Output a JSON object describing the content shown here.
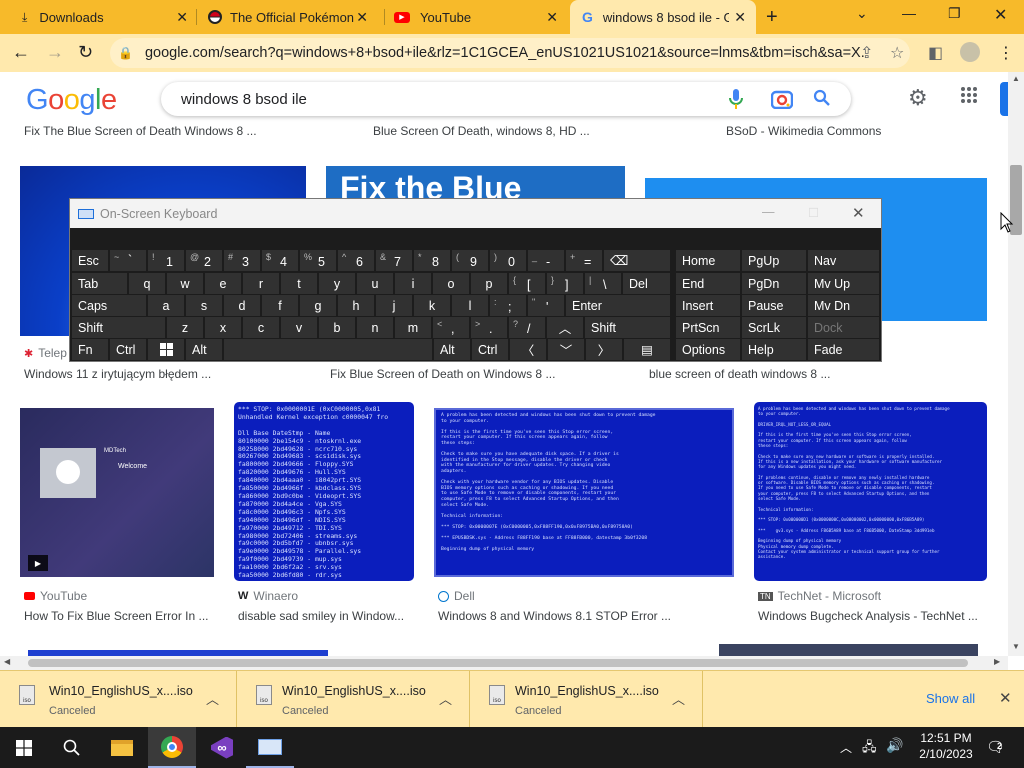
{
  "browser": {
    "tabs": [
      {
        "title": "Downloads",
        "icon": "download-icon"
      },
      {
        "title": "The Official Pokémon W",
        "icon": "pokeball-icon"
      },
      {
        "title": "YouTube",
        "icon": "youtube-icon"
      },
      {
        "title": "windows 8 bsod ile - G",
        "icon": "google-icon",
        "active": true
      }
    ],
    "new_tab": "+",
    "url": "google.com/search?q=windows+8+bsod+ile&rlz=1C1GCEA_enUS1021US1021&source=lnms&tbm=isch&sa=X...",
    "colors": {
      "tab_strip": "#f7ba2a",
      "toolbar": "#ffe9ad"
    }
  },
  "google": {
    "logo": [
      "G",
      "o",
      "o",
      "g",
      "l",
      "e"
    ],
    "query": "windows 8 bsod ile"
  },
  "results": {
    "row0_captions": [
      "Fix The Blue Screen of Death Windows 8 ...",
      "Blue Screen Of Death, windows 8, HD ...",
      "BSoD - Wikimedia Commons"
    ],
    "row1": {
      "fix_text": "Fix the Blue",
      "sources": [
        "Telep"
      ],
      "captions": [
        "Windows 11 z irytującym błędem ...",
        "Fix Blue Screen of Death on Windows 8 ...",
        "blue screen of death windows 8 ..."
      ]
    },
    "row2": [
      {
        "source": "YouTube",
        "caption": "How To Fix Blue Screen Error In ...",
        "thumb_brand": "MDTech",
        "thumb_text": "Welcome"
      },
      {
        "source": "Winaero",
        "caption": "disable sad smiley in Window..."
      },
      {
        "source": "Dell",
        "caption": "Windows 8 and Windows 8.1 STOP Error ..."
      },
      {
        "source": "TechNet - Microsoft",
        "caption": "Windows Bugcheck Analysis - TechNet ..."
      }
    ],
    "bsod2_text": "*** STOP: 0x0000001E (0xC0000005,0x81\nUnhandled Kernel exception c0000047 fro\n\nDll Base DateStmp - Name\n80100000 2be154c9 - ntoskrnl.exe\n80258000 2bd49628 - ncrc710.sys\n80267000 2bd49683 - scsidisk.sys\nfa800000 2bd49666 - Floppy.SYS\nfa820000 2bd49676 - Hull.SYS\nfa840000 2bd4aaa0 - i8042prt.SYS\nfa850000 2bd4966f - kbdclass.SYS\nfa860000 2bd9c0be - Videoprt.SYS\nfa870000 2bd4a4ce - Vga.SYS\nfa8c0000 2bd496c3 - Npfs.SYS\nfa940000 2bd496df - NDIS.SYS\nfa970000 2bd49712 - TDI.SYS\nfa980000 2bd72406 - streams.sys\nfa9c0000 2bd5bfd7 - ubnbsr.sys\nfa9e0000 2bd49578 - Parallel.sys\nfa9f0000 2bd49739 - mup.sys\nfaa10000 2bd6f2a2 - srv.sys\nfaa50000 2bd6fd80 - rdr.sys",
    "bsod3_text": "A problem has been detected and windows has been shut down to prevent damage\nto your computer.\n\nIf this is the first time you've seen this Stop error screen,\nrestart your computer. If this screen appears again, follow\nthese steps:\n\nCheck to make sure you have adequate disk space. If a driver is\nidentified in the Stop message, disable the driver or check\nwith the manufacturer for driver updates. Try changing video\nadapters.\n\nCheck with your hardware vendor for any BIOS updates. Disable\nBIOS memory options such as caching or shadowing. If you need\nto use Safe Mode to remove or disable components, restart your\ncomputer, press F8 to select Advanced Startup Options, and then\nselect Safe Mode.\n\nTechnical information:\n\n*** STOP: 0x0000007E (0xC0000005,0xF88FF190,0x0xF8975BA0,0xF89758A0)\n\n*** EPUSBDSK.sys - Address F88FF190 base at FF88FB000, datestamp 3b0f3208\n\nBeginning dump of physical memory",
    "bsod4_text": "A problem has been detected and windows has been shut down to prevent damage\nto your computer.\n\nDRIVER_IRQL_NOT_LESS_OR_EQUAL\n\nIf this is the first time you've seen this Stop error screen,\nrestart your computer. If this screen appears again, follow\nthese steps:\n\nCheck to make sure any new hardware or software is properly installed.\nIf this is a new installation, ask your hardware or software manufacturer\nfor any Windows updates you might need.\n\nIf problems continue, disable or remove any newly installed hardware\nor software. Disable BIOS memory options such as caching or shadowing.\nIf you need to use Safe Mode to remove or disable components, restart\nyour computer, press F8 to select Advanced Startup Options, and then\nselect Safe Mode.\n\nTechnical information:\n\n*** STOP: 0x000000D1 (0x0000000C,0x00000002,0x00000000,0xF86B5A89)\n\n***    gv3.sys - Address F86B5A89 base at F86B5000, DateStamp 3dd991eb\n\nBeginning dump of physical memory\nPhysical memory dump complete.\nContact your system administrator or technical support group for further\nassistance."
  },
  "osk": {
    "title": "On-Screen Keyboard",
    "row1": [
      "Esc",
      "~",
      "`",
      "!",
      "1",
      "@",
      "2",
      "#",
      "3",
      "$",
      "4",
      "%",
      "5",
      "^",
      "6",
      "&",
      "7",
      "*",
      "8",
      "(",
      "9",
      ")",
      "0",
      "_",
      "-",
      "+",
      "="
    ],
    "row2": [
      "Tab",
      "q",
      "w",
      "e",
      "r",
      "t",
      "y",
      "u",
      "i",
      "o",
      "p",
      "{",
      "[",
      "}",
      "]",
      "|",
      "\\",
      "Del"
    ],
    "row3": [
      "Caps",
      "a",
      "s",
      "d",
      "f",
      "g",
      "h",
      "j",
      "k",
      "l",
      ":",
      ";",
      "\"",
      "'",
      "Enter"
    ],
    "row4": [
      "Shift",
      "z",
      "x",
      "c",
      "v",
      "b",
      "n",
      "m",
      "<",
      ",",
      ">",
      ".",
      "?",
      "/",
      "Shift"
    ],
    "row5": [
      "Fn",
      "Ctrl",
      "Alt",
      "Alt",
      "Ctrl"
    ],
    "nav": [
      "Home",
      "PgUp",
      "Nav",
      "End",
      "PgDn",
      "Mv Up",
      "Insert",
      "Pause",
      "Mv Dn",
      "PrtScn",
      "ScrLk",
      "Dock",
      "Options",
      "Help",
      "Fade"
    ]
  },
  "downloads": {
    "items": [
      {
        "name": "Win10_EnglishUS_x....iso",
        "status": "Canceled"
      },
      {
        "name": "Win10_EnglishUS_x....iso",
        "status": "Canceled"
      },
      {
        "name": "Win10_EnglishUS_x....iso",
        "status": "Canceled"
      }
    ],
    "file_ext": "iso",
    "show_all": "Show all"
  },
  "taskbar": {
    "time": "12:51 PM",
    "date": "2/10/2023",
    "notif_count": "2"
  }
}
